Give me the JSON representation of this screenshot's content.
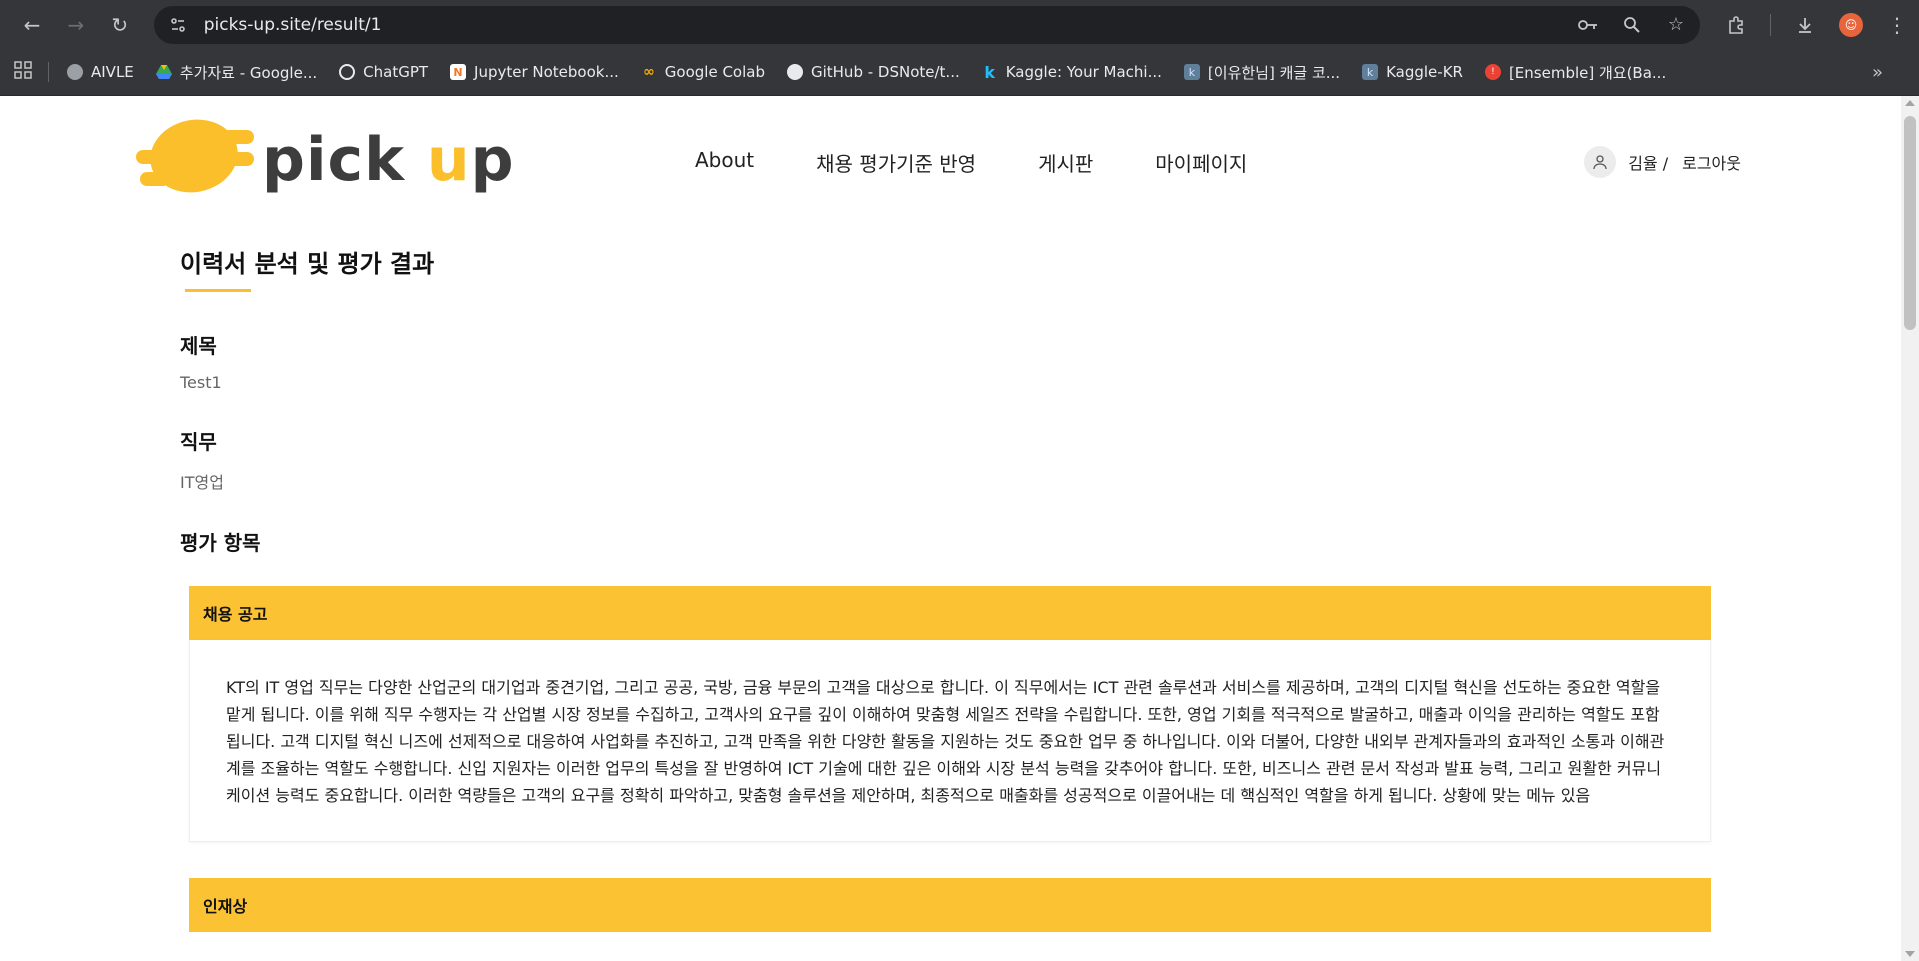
{
  "browser": {
    "url": "picks-up.site/result/1",
    "bookmarks": [
      {
        "label": "AIVLE",
        "icon": "globe-icon",
        "color": "#9aa0a6"
      },
      {
        "label": "추가자료 - Google...",
        "icon": "google-drive-icon",
        "color": "#34a853"
      },
      {
        "label": "ChatGPT",
        "icon": "chatgpt-icon",
        "color": "#e8eaed"
      },
      {
        "label": "Jupyter Notebook...",
        "icon": "jupyter-icon",
        "color": "#f37726"
      },
      {
        "label": "Google Colab",
        "icon": "colab-icon",
        "color": "#f9ab00"
      },
      {
        "label": "GitHub - DSNote/t...",
        "icon": "github-icon",
        "color": "#e8eaed"
      },
      {
        "label": "Kaggle: Your Machi...",
        "icon": "kaggle-icon",
        "color": "#20beff"
      },
      {
        "label": "[이유한님] 캐글 코...",
        "icon": "kaggle-icon",
        "color": "#5f7f9a"
      },
      {
        "label": "Kaggle-KR",
        "icon": "kaggle-icon",
        "color": "#5f7f9a"
      },
      {
        "label": "[Ensemble] 개요(Ba...",
        "icon": "velog-icon",
        "color": "#ea4335"
      }
    ]
  },
  "header": {
    "logo_text_1": "pick ",
    "logo_text_2": "u",
    "logo_text_3": "p",
    "nav": [
      "About",
      "채용 평가기준 반영",
      "게시판",
      "마이페이지"
    ],
    "user_name": "김율 /",
    "logout": "로그아웃"
  },
  "main": {
    "page_title": "이력서 분석 및 평가 결과",
    "title_label": "제목",
    "title_value": "Test1",
    "job_label": "직무",
    "job_value": "IT영업",
    "eval_label": "평가 항목",
    "cards": [
      {
        "heading": "채용 공고",
        "body": "KT의 IT 영업 직무는 다양한 산업군의 대기업과 중견기업, 그리고 공공, 국방, 금융 부문의 고객을 대상으로 합니다. 이 직무에서는 ICT 관련 솔루션과 서비스를 제공하며, 고객의 디지털 혁신을 선도하는 중요한 역할을 맡게 됩니다. 이를 위해 직무 수행자는 각 산업별 시장 정보를 수집하고, 고객사의 요구를 깊이 이해하여 맞춤형 세일즈 전략을 수립합니다. 또한, 영업 기회를 적극적으로 발굴하고, 매출과 이익을 관리하는 역할도 포함됩니다. 고객 디지털 혁신 니즈에 선제적으로 대응하여 사업화를 추진하고, 고객 만족을 위한 다양한 활동을 지원하는 것도 중요한 업무 중 하나입니다. 이와 더불어, 다양한 내외부 관계자들과의 효과적인 소통과 이해관계를 조율하는 역할도 수행합니다. 신입 지원자는 이러한 업무의 특성을 잘 반영하여 ICT 기술에 대한 깊은 이해와 시장 분석 능력을 갖추어야 합니다. 또한, 비즈니스 관련 문서 작성과 발표 능력, 그리고 원활한 커뮤니케이션 능력도 중요합니다. 이러한 역량들은 고객의 요구를 정확히 파악하고, 맞춤형 솔루션을 제안하며, 최종적으로 매출화를 성공적으로 이끌어내는 데 핵심적인 역할을 하게 됩니다. 상황에 맞는 메뉴 있음"
      },
      {
        "heading": "인재상"
      }
    ]
  },
  "colors": {
    "accent": "#fbc233",
    "chrome_bg": "#35363a"
  }
}
